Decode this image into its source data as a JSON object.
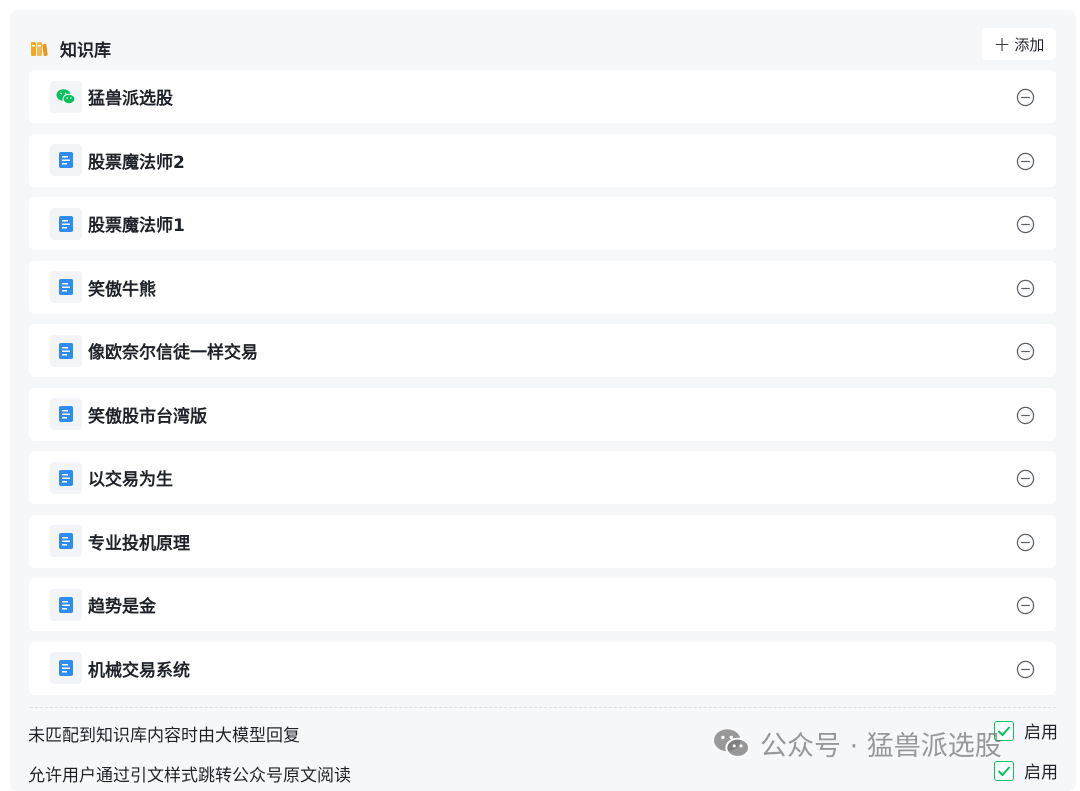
{
  "header": {
    "title": "知识库",
    "add_label": "添加",
    "accent_color": "#f5a623"
  },
  "knowledge_bases": [
    {
      "label": "猛兽派选股",
      "icon": "wechat-icon"
    },
    {
      "label": "股票魔法师2",
      "icon": "document-icon"
    },
    {
      "label": "股票魔法师1",
      "icon": "document-icon"
    },
    {
      "label": "笑傲牛熊",
      "icon": "document-icon"
    },
    {
      "label": "像欧奈尔信徒一样交易",
      "icon": "document-icon"
    },
    {
      "label": "笑傲股市台湾版",
      "icon": "document-icon"
    },
    {
      "label": "以交易为生",
      "icon": "document-icon"
    },
    {
      "label": "专业投机原理",
      "icon": "document-icon"
    },
    {
      "label": "趋势是金",
      "icon": "document-icon"
    },
    {
      "label": "机械交易系统",
      "icon": "document-icon"
    }
  ],
  "options": [
    {
      "label": "未匹配到知识库内容时由大模型回复",
      "control_label": "启用",
      "checked": true
    },
    {
      "label": "允许用户通过引文样式跳转公众号原文阅读",
      "control_label": "启用",
      "checked": true
    }
  ],
  "watermark": {
    "text": "公众号 · 猛兽派选股"
  },
  "colors": {
    "doc_icon": "#2f8cf0",
    "wechat_green": "#07c160",
    "panel_bg": "#f6f7f9"
  }
}
